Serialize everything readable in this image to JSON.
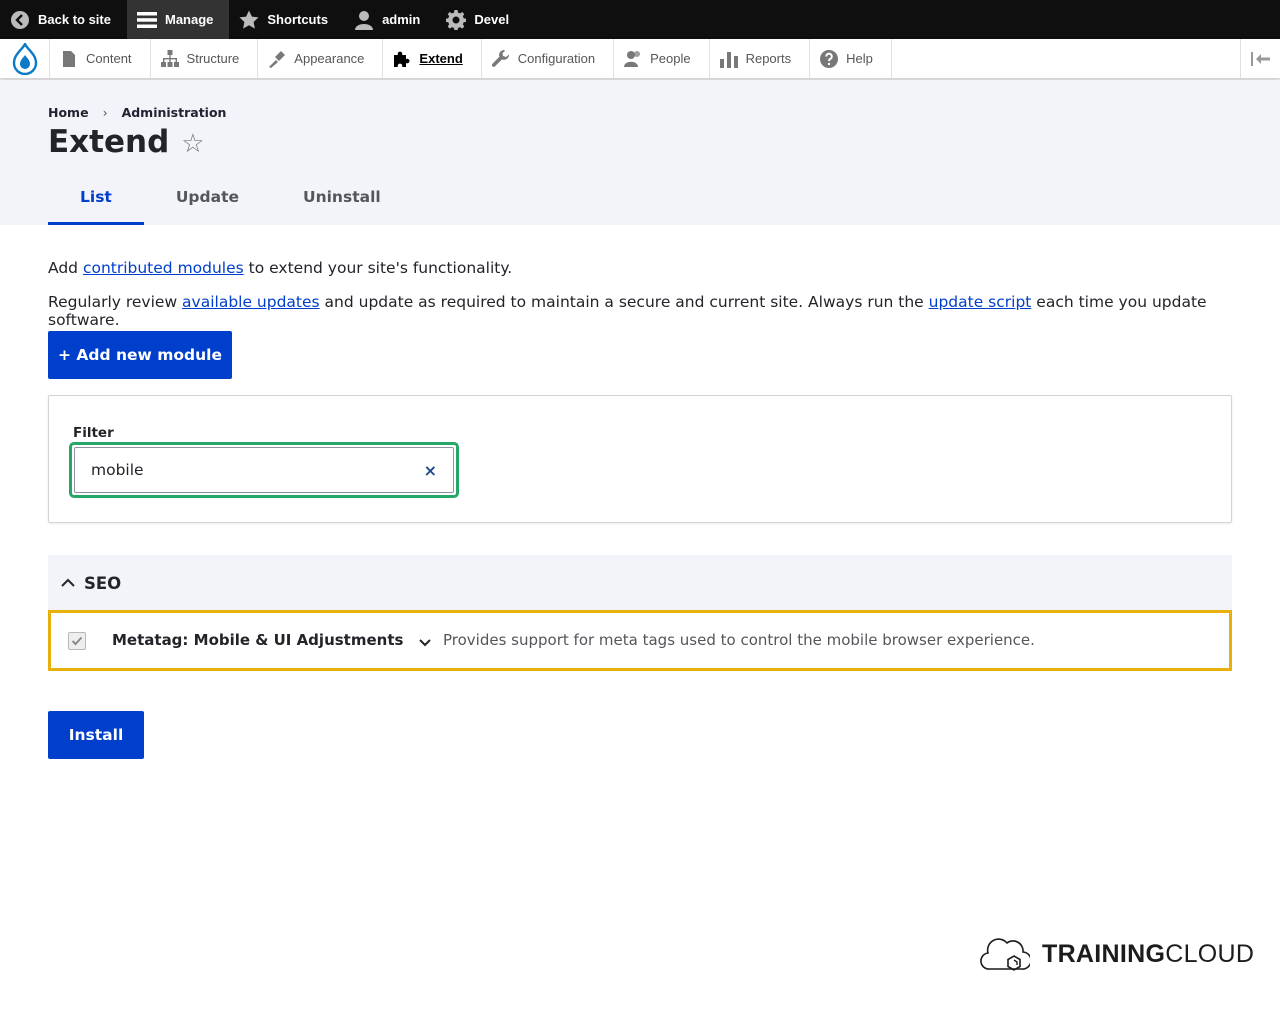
{
  "toolbar": {
    "items": [
      {
        "label": "Back to site",
        "icon": "back-arrow-icon"
      },
      {
        "label": "Manage",
        "icon": "hamburger-menu-icon"
      },
      {
        "label": "Shortcuts",
        "icon": "star-icon"
      },
      {
        "label": "admin",
        "icon": "user-icon"
      },
      {
        "label": "Devel",
        "icon": "gear-icon"
      }
    ]
  },
  "tray": {
    "items": [
      {
        "label": "Content",
        "icon": "file-icon"
      },
      {
        "label": "Structure",
        "icon": "sitemap-icon"
      },
      {
        "label": "Appearance",
        "icon": "paintbrush-icon"
      },
      {
        "label": "Extend",
        "icon": "puzzle-icon"
      },
      {
        "label": "Configuration",
        "icon": "wrench-icon"
      },
      {
        "label": "People",
        "icon": "people-icon"
      },
      {
        "label": "Reports",
        "icon": "bar-chart-icon"
      },
      {
        "label": "Help",
        "icon": "help-icon"
      }
    ],
    "active": "Extend"
  },
  "breadcrumb": {
    "items": [
      "Home",
      "Administration"
    ],
    "separator": "›"
  },
  "page": {
    "title": "Extend",
    "star": "☆"
  },
  "tabs": [
    {
      "label": "List"
    },
    {
      "label": "Update"
    },
    {
      "label": "Uninstall"
    }
  ],
  "intro": {
    "line1_pre": "Add ",
    "line1_link": "contributed modules",
    "line1_post": " to extend your site's functionality.",
    "line2_pre": "Regularly review ",
    "line2_link1": "available updates",
    "line2_mid": " and update as required to maintain a secure and current site. Always run the ",
    "line2_link2": "update script",
    "line2_post": " each time you update software."
  },
  "buttons": {
    "add_module": "+ Add new module",
    "install": "Install"
  },
  "filter": {
    "label": "Filter",
    "value": "mobile",
    "clear": "×"
  },
  "group": {
    "title": "SEO"
  },
  "module": {
    "name": "Metatag: Mobile & UI Adjustments",
    "description": "Provides support for meta tags used to control the mobile browser experience.",
    "checked": true
  },
  "brand": {
    "bold": "TRAINING",
    "light": "CLOUD"
  },
  "colors": {
    "primary": "#003ecc",
    "focus": "#26a769",
    "highlight": "#e8b00c"
  }
}
